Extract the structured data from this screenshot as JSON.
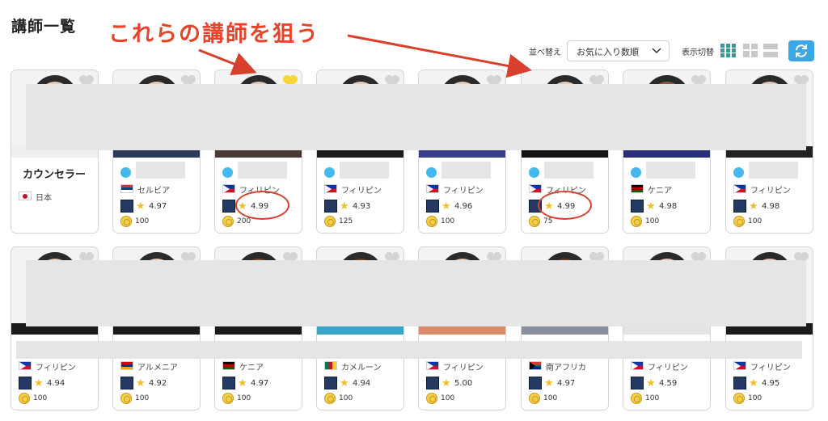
{
  "header": {
    "title": "講師一覧",
    "annotation": "これらの講師を狙う"
  },
  "controls": {
    "sort_label": "並べ替え",
    "sort_selected": "お気に入り数順",
    "view_label": "表示切替",
    "view_modes": [
      "grid-large-icon",
      "grid-small-icon",
      "list-icon"
    ],
    "refresh_icon": "refresh-icon"
  },
  "colors": {
    "annotation": "#e8442a",
    "accent": "#3aa8e6",
    "star": "#f1bf2c",
    "favorite_active": "#f7d833",
    "favorite_inactive": "#d4d4d4",
    "redaction": "#e5e5e5"
  },
  "teachers_row1": [
    {
      "title": "カウンセラー",
      "country": "日本",
      "rating": "",
      "points": "",
      "favorite": false,
      "counselor": true
    },
    {
      "country": "セルビア",
      "rating": "4.97",
      "points": "100",
      "favorite": false
    },
    {
      "country": "フィリピン",
      "rating": "4.99",
      "points": "200",
      "favorite": true,
      "highlighted": true
    },
    {
      "country": "フィリピン",
      "rating": "4.93",
      "points": "125",
      "favorite": false
    },
    {
      "country": "フィリピン",
      "rating": "4.96",
      "points": "100",
      "favorite": false
    },
    {
      "country": "フィリピン",
      "rating": "4.99",
      "points": "75",
      "favorite": false,
      "highlighted": true
    },
    {
      "country": "ケニア",
      "rating": "4.98",
      "points": "100",
      "favorite": false
    },
    {
      "country": "フィリピン",
      "rating": "4.98",
      "points": "100",
      "favorite": false
    }
  ],
  "teachers_row2": [
    {
      "country": "フィリピン",
      "rating": "4.94",
      "points": "100",
      "favorite": false
    },
    {
      "country": "アルメニア",
      "rating": "4.92",
      "points": "100",
      "favorite": false
    },
    {
      "country": "ケニア",
      "rating": "4.97",
      "points": "100",
      "favorite": false
    },
    {
      "country": "カメルーン",
      "rating": "4.94",
      "points": "100",
      "favorite": false
    },
    {
      "country": "フィリピン",
      "rating": "5.00",
      "points": "100",
      "favorite": false
    },
    {
      "country": "南アフリカ",
      "rating": "4.97",
      "points": "100",
      "favorite": false
    },
    {
      "country": "フィリピン",
      "rating": "4.59",
      "points": "100",
      "favorite": false
    },
    {
      "country": "フィリピン",
      "rating": "4.95",
      "points": "100",
      "favorite": false
    }
  ]
}
